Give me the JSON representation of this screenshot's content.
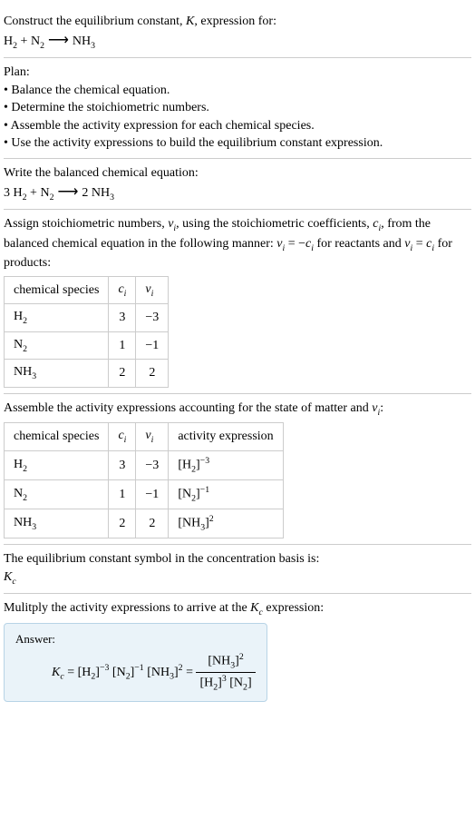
{
  "header": {
    "title_prefix": "Construct the equilibrium constant, ",
    "title_italic": "K",
    "title_suffix": ", expression for:",
    "equation_h2": "H",
    "equation_plus": " + ",
    "equation_n2": "N",
    "equation_arrow": " ⟶ ",
    "equation_nh3": "NH",
    "sub2": "2",
    "sub3": "3"
  },
  "plan": {
    "title": "Plan:",
    "item1": "• Balance the chemical equation.",
    "item2": "• Determine the stoichiometric numbers.",
    "item3": "• Assemble the activity expression for each chemical species.",
    "item4": "• Use the activity expressions to build the equilibrium constant expression."
  },
  "balanced": {
    "title": "Write the balanced chemical equation:",
    "coef_h2": "3 ",
    "h2": "H",
    "plus": " + ",
    "n2": "N",
    "arrow": " ⟶ ",
    "coef_nh3": "2 ",
    "nh3": "NH",
    "sub2": "2",
    "sub3": "3"
  },
  "stoich": {
    "text_p1": "Assign stoichiometric numbers, ",
    "nu_i": "ν",
    "sub_i": "i",
    "text_p2": ", using the stoichiometric coefficients, ",
    "c_i": "c",
    "text_p3": ", from the balanced chemical equation in the following manner: ",
    "eq1_lhs": "ν",
    "eq1_eq": " = −",
    "eq1_rhs": "c",
    "text_p4": " for reactants and ",
    "eq2_lhs": "ν",
    "eq2_eq": " = ",
    "eq2_rhs": "c",
    "text_p5": " for products:",
    "table": {
      "h1": "chemical species",
      "h2": "c",
      "h2_sub": "i",
      "h3": "ν",
      "h3_sub": "i",
      "rows": [
        {
          "species": "H",
          "sub": "2",
          "ci": "3",
          "vi": "−3"
        },
        {
          "species": "N",
          "sub": "2",
          "ci": "1",
          "vi": "−1"
        },
        {
          "species": "NH",
          "sub": "3",
          "ci": "2",
          "vi": "2"
        }
      ]
    }
  },
  "activity": {
    "text_p1": "Assemble the activity expressions accounting for the state of matter and ",
    "nu": "ν",
    "sub_i": "i",
    "text_p2": ":",
    "table": {
      "h1": "chemical species",
      "h2": "c",
      "h2_sub": "i",
      "h3": "ν",
      "h3_sub": "i",
      "h4": "activity expression",
      "rows": [
        {
          "species": "H",
          "sub": "2",
          "ci": "3",
          "vi": "−3",
          "expr_base": "[H",
          "expr_sub": "2",
          "expr_close": "]",
          "expr_sup": "−3"
        },
        {
          "species": "N",
          "sub": "2",
          "ci": "1",
          "vi": "−1",
          "expr_base": "[N",
          "expr_sub": "2",
          "expr_close": "]",
          "expr_sup": "−1"
        },
        {
          "species": "NH",
          "sub": "3",
          "ci": "2",
          "vi": "2",
          "expr_base": "[NH",
          "expr_sub": "3",
          "expr_close": "]",
          "expr_sup": "2"
        }
      ]
    }
  },
  "kc_symbol": {
    "text": "The equilibrium constant symbol in the concentration basis is:",
    "symbol": "K",
    "sub": "c"
  },
  "multiply": {
    "text_p1": "Mulitply the activity expressions to arrive at the ",
    "kc": "K",
    "kc_sub": "c",
    "text_p2": " expression:"
  },
  "answer": {
    "label": "Answer:",
    "kc": "K",
    "kc_sub": "c",
    "eq": " = ",
    "h2_open": "[H",
    "h2_sub": "2",
    "close": "]",
    "h2_sup": "−3",
    "n2_open": " [N",
    "n2_sub": "2",
    "n2_sup": "−1",
    "nh3_open": " [NH",
    "nh3_sub": "3",
    "nh3_sup": "2",
    "eq2": " = ",
    "num_nh3_open": "[NH",
    "num_nh3_sub": "3",
    "num_nh3_sup": "2",
    "den_h2_open": "[H",
    "den_h2_sub": "2",
    "den_h2_sup": "3",
    "den_n2_open": " [N",
    "den_n2_sub": "2"
  }
}
